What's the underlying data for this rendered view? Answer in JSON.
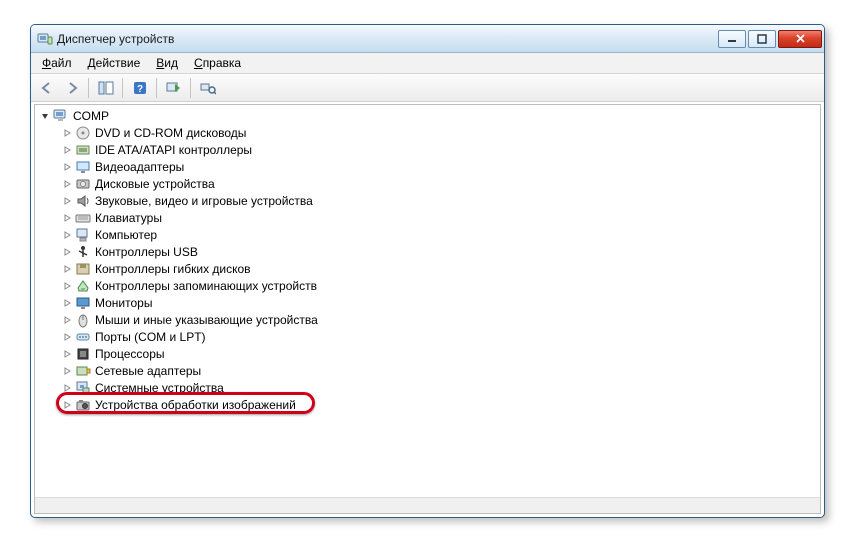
{
  "window": {
    "title": "Диспетчер устройств"
  },
  "menu": {
    "file": {
      "label": "Файл",
      "ul": "Ф"
    },
    "action": {
      "label": "Действие",
      "ul": "Д"
    },
    "view": {
      "label": "Вид",
      "ul": "В"
    },
    "help": {
      "label": "Справка",
      "ul": "С"
    }
  },
  "tree": {
    "root": {
      "label": "COMP"
    },
    "items": [
      {
        "label": "DVD и CD-ROM дисководы",
        "icon": "disc"
      },
      {
        "label": "IDE ATA/ATAPI контроллеры",
        "icon": "ide"
      },
      {
        "label": "Видеоадаптеры",
        "icon": "display"
      },
      {
        "label": "Дисковые устройства",
        "icon": "hdd"
      },
      {
        "label": "Звуковые, видео и игровые устройства",
        "icon": "audio"
      },
      {
        "label": "Клавиатуры",
        "icon": "keyboard"
      },
      {
        "label": "Компьютер",
        "icon": "computer"
      },
      {
        "label": "Контроллеры USB",
        "icon": "usb"
      },
      {
        "label": "Контроллеры гибких дисков",
        "icon": "floppyctl"
      },
      {
        "label": "Контроллеры запоминающих устройств",
        "icon": "storage"
      },
      {
        "label": "Мониторы",
        "icon": "monitor"
      },
      {
        "label": "Мыши и иные указывающие устройства",
        "icon": "mouse"
      },
      {
        "label": "Порты (COM и LPT)",
        "icon": "port"
      },
      {
        "label": "Процессоры",
        "icon": "cpu"
      },
      {
        "label": "Сетевые адаптеры",
        "icon": "nic"
      },
      {
        "label": "Системные устройства",
        "icon": "system"
      },
      {
        "label": "Устройства обработки изображений",
        "icon": "imaging"
      }
    ]
  },
  "highlight_index": 16
}
